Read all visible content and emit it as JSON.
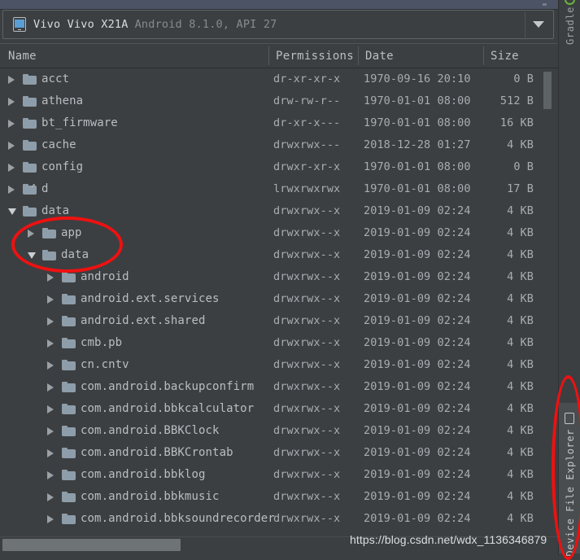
{
  "colors": {
    "background": "#3c3f41",
    "titlebar": "#4b5364",
    "text_primary": "#b9bec2",
    "text_dim": "#868b8f",
    "folder": "#8e9daa",
    "annotation_red": "#ee1111",
    "gradle_green": "#6cb33f",
    "device_screen_blue": "#5a9fd4"
  },
  "device_selector": {
    "icon": "phone-icon",
    "device_name": "Vivo Vivo X21A",
    "device_meta": "Android 8.1.0, API 27",
    "dropdown_icon": "chevron-down-icon"
  },
  "columns": [
    {
      "key": "name",
      "label": "Name"
    },
    {
      "key": "permissions",
      "label": "Permissions"
    },
    {
      "key": "date",
      "label": "Date"
    },
    {
      "key": "size",
      "label": "Size"
    }
  ],
  "rows": [
    {
      "name": "acct",
      "level": 0,
      "state": "closed",
      "icon": "folder-icon",
      "permissions": "dr-xr-xr-x",
      "date": "1970-09-16 20:10",
      "size": "0 B"
    },
    {
      "name": "athena",
      "level": 0,
      "state": "closed",
      "icon": "folder-icon",
      "permissions": "drw-rw-r--",
      "date": "1970-01-01 08:00",
      "size": "512 B"
    },
    {
      "name": "bt_firmware",
      "level": 0,
      "state": "closed",
      "icon": "folder-icon",
      "permissions": "dr-xr-x---",
      "date": "1970-01-01 08:00",
      "size": "16 KB"
    },
    {
      "name": "cache",
      "level": 0,
      "state": "closed",
      "icon": "folder-icon",
      "permissions": "drwxrwx---",
      "date": "2018-12-28 01:27",
      "size": "4 KB"
    },
    {
      "name": "config",
      "level": 0,
      "state": "closed",
      "icon": "folder-icon",
      "permissions": "drwxr-xr-x",
      "date": "1970-01-01 08:00",
      "size": "0 B"
    },
    {
      "name": "d",
      "level": 0,
      "state": "closed",
      "icon": "folder-link-icon",
      "permissions": "lrwxrwxrwx",
      "date": "1970-01-01 08:00",
      "size": "17 B"
    },
    {
      "name": "data",
      "level": 0,
      "state": "open",
      "icon": "folder-icon",
      "permissions": "drwxrwx--x",
      "date": "2019-01-09 02:24",
      "size": "4 KB"
    },
    {
      "name": "app",
      "level": 1,
      "state": "closed",
      "icon": "folder-icon",
      "permissions": "drwxrwx--x",
      "date": "2019-01-09 02:24",
      "size": "4 KB"
    },
    {
      "name": "data",
      "level": 1,
      "state": "open",
      "icon": "folder-icon",
      "permissions": "drwxrwx--x",
      "date": "2019-01-09 02:24",
      "size": "4 KB"
    },
    {
      "name": "android",
      "level": 2,
      "state": "closed",
      "icon": "folder-icon",
      "permissions": "drwxrwx--x",
      "date": "2019-01-09 02:24",
      "size": "4 KB"
    },
    {
      "name": "android.ext.services",
      "level": 2,
      "state": "closed",
      "icon": "folder-icon",
      "permissions": "drwxrwx--x",
      "date": "2019-01-09 02:24",
      "size": "4 KB"
    },
    {
      "name": "android.ext.shared",
      "level": 2,
      "state": "closed",
      "icon": "folder-icon",
      "permissions": "drwxrwx--x",
      "date": "2019-01-09 02:24",
      "size": "4 KB"
    },
    {
      "name": "cmb.pb",
      "level": 2,
      "state": "closed",
      "icon": "folder-icon",
      "permissions": "drwxrwx--x",
      "date": "2019-01-09 02:24",
      "size": "4 KB"
    },
    {
      "name": "cn.cntv",
      "level": 2,
      "state": "closed",
      "icon": "folder-icon",
      "permissions": "drwxrwx--x",
      "date": "2019-01-09 02:24",
      "size": "4 KB"
    },
    {
      "name": "com.android.backupconfirm",
      "level": 2,
      "state": "closed",
      "icon": "folder-icon",
      "permissions": "drwxrwx--x",
      "date": "2019-01-09 02:24",
      "size": "4 KB"
    },
    {
      "name": "com.android.bbkcalculator",
      "level": 2,
      "state": "closed",
      "icon": "folder-icon",
      "permissions": "drwxrwx--x",
      "date": "2019-01-09 02:24",
      "size": "4 KB"
    },
    {
      "name": "com.android.BBKClock",
      "level": 2,
      "state": "closed",
      "icon": "folder-icon",
      "permissions": "drwxrwx--x",
      "date": "2019-01-09 02:24",
      "size": "4 KB"
    },
    {
      "name": "com.android.BBKCrontab",
      "level": 2,
      "state": "closed",
      "icon": "folder-icon",
      "permissions": "drwxrwx--x",
      "date": "2019-01-09 02:24",
      "size": "4 KB"
    },
    {
      "name": "com.android.bbklog",
      "level": 2,
      "state": "closed",
      "icon": "folder-icon",
      "permissions": "drwxrwx--x",
      "date": "2019-01-09 02:24",
      "size": "4 KB"
    },
    {
      "name": "com.android.bbkmusic",
      "level": 2,
      "state": "closed",
      "icon": "folder-icon",
      "permissions": "drwxrwx--x",
      "date": "2019-01-09 02:24",
      "size": "4 KB"
    },
    {
      "name": "com.android.bbksoundrecorder",
      "level": 2,
      "state": "closed",
      "icon": "folder-icon",
      "permissions": "drwxrwx--x",
      "date": "2019-01-09 02:24",
      "size": "4 KB"
    }
  ],
  "tool_strip": {
    "gradle": {
      "label": "Gradle",
      "icon": "gradle-icon"
    },
    "device_file_explorer": {
      "label": "Device File Explorer",
      "icon": "device-file-explorer-icon",
      "active": true
    }
  },
  "annotations": {
    "left_ellipse_target": "data-app-data-rows",
    "right_ellipse_target": "device-file-explorer-tab"
  },
  "watermark": "https://blog.csdn.net/wdx_1136346879"
}
